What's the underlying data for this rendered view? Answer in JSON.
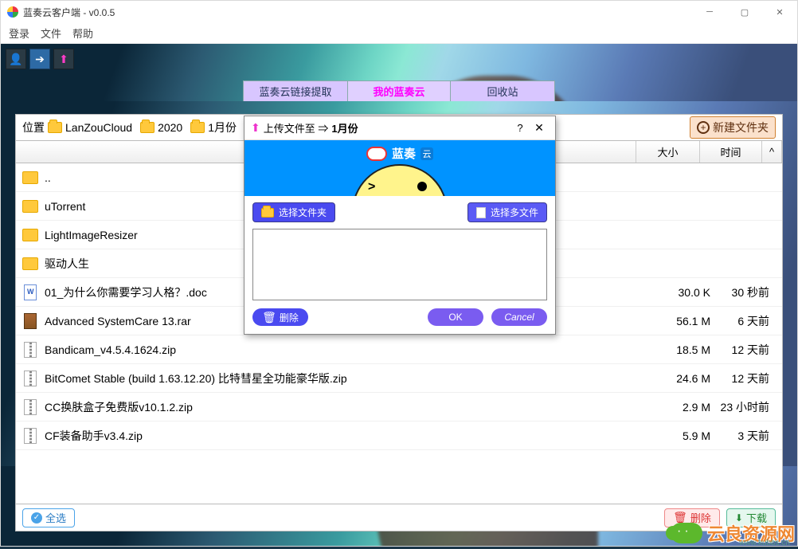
{
  "window": {
    "title": "蓝奏云客户端 - v0.0.5"
  },
  "menu": {
    "login": "登录",
    "file": "文件",
    "help": "帮助"
  },
  "inner_tabs": {
    "extract": "蓝奏云链接提取",
    "mine": "我的蓝奏云",
    "trash": "回收站"
  },
  "breadcrumb": {
    "label": "位置",
    "items": [
      "LanZouCloud",
      "2020",
      "1月份"
    ]
  },
  "new_folder_btn": "新建文件夹",
  "columns": {
    "size": "大小",
    "time": "时间"
  },
  "files": [
    {
      "icon": "folder",
      "name": "..",
      "size": "",
      "time": ""
    },
    {
      "icon": "folder",
      "name": "uTorrent",
      "size": "",
      "time": ""
    },
    {
      "icon": "folder",
      "name": "LightImageResizer",
      "size": "",
      "time": ""
    },
    {
      "icon": "folder",
      "name": "驱动人生",
      "size": "",
      "time": ""
    },
    {
      "icon": "doc",
      "name": "01_为什么你需要学习人格？.doc",
      "size": "30.0 K",
      "time": "30 秒前"
    },
    {
      "icon": "rar",
      "name": "Advanced SystemCare 13.rar",
      "size": "56.1 M",
      "time": "6 天前"
    },
    {
      "icon": "zip",
      "name": "Bandicam_v4.5.4.1624.zip",
      "size": "18.5 M",
      "time": "12 天前"
    },
    {
      "icon": "zip",
      "name": "BitComet Stable (build 1.63.12.20) 比特彗星全功能豪华版.zip",
      "size": "24.6 M",
      "time": "12 天前"
    },
    {
      "icon": "zip",
      "name": "CC换肤盒子免费版v10.1.2.zip",
      "size": "2.9 M",
      "time": "23 小时前"
    },
    {
      "icon": "zip",
      "name": "CF装备助手v3.4.zip",
      "size": "5.9 M",
      "time": "3 天前"
    }
  ],
  "footer": {
    "select_all": "全选",
    "delete": "删除",
    "download": "下载"
  },
  "dialog": {
    "title_prefix": "上传文件至 ⇒",
    "dest": "1月份",
    "brand": "蓝奏",
    "brand_suffix": "云",
    "select_folder": "选择文件夹",
    "select_multi": "选择多文件",
    "delete": "删除",
    "ok": "OK",
    "cancel": "Cancel"
  },
  "watermark": {
    "text": "云良资源网",
    "url": "www.kubbs.cn"
  }
}
